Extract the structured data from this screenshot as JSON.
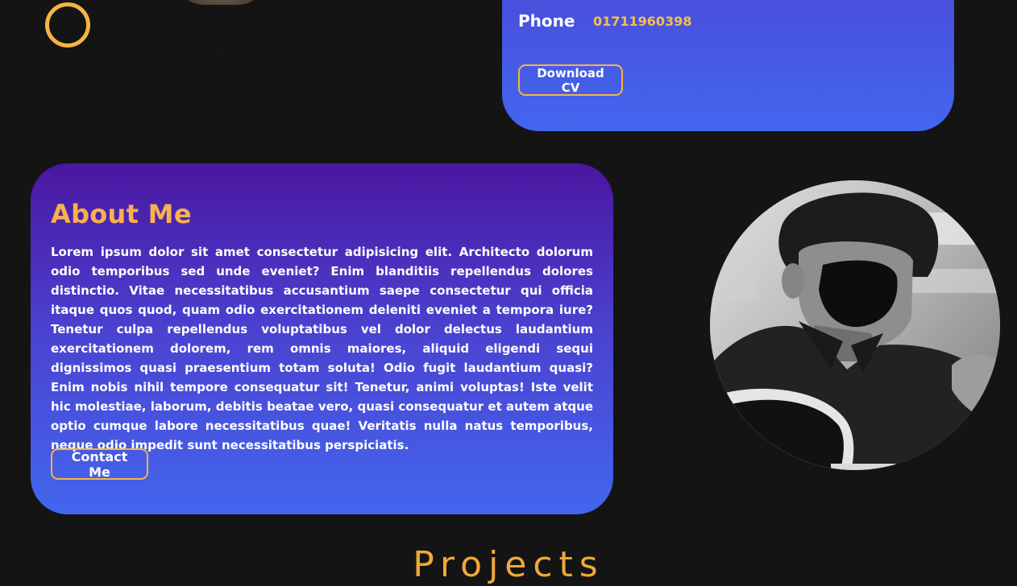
{
  "contact": {
    "phone_label": "Phone",
    "phone_value": "01711960398",
    "download_button": "Download CV"
  },
  "about": {
    "title": "About Me",
    "body": "Lorem ipsum dolor sit amet consectetur adipisicing elit. Architecto dolorum odio temporibus sed unde eveniet? Enim blanditiis repellendus dolores distinctio. Vitae necessitatibus accusantium saepe consectetur qui officia itaque quos quod, quam odio exercitationem deleniti eveniet a tempora iure? Tenetur culpa repellendus voluptatibus vel dolor delectus laudantium exercitationem dolorem, rem omnis maiores, aliquid eligendi sequi dignissimos quasi praesentium totam soluta! Odio fugit laudantium quasi? Enim nobis nihil tempore consequatur sit! Tenetur, animi voluptas! Iste velit hic molestiae, laborum, debitis beatae vero, quasi consequatur et autem atque optio cumque labore necessitatibus quae! Veritatis nulla natus temporibus, neque odio impedit sunt necessitatibus perspiciatis.",
    "contact_button": "Contact Me"
  },
  "projects": {
    "heading": "Projects"
  },
  "colors": {
    "background": "#141414",
    "accent": "#f5b443",
    "card_gradient_top": "#4b16a0",
    "card_gradient_bottom": "#4366ee"
  },
  "icons": {
    "ring": "decorative-ring-icon",
    "portrait": "profile-photo"
  }
}
